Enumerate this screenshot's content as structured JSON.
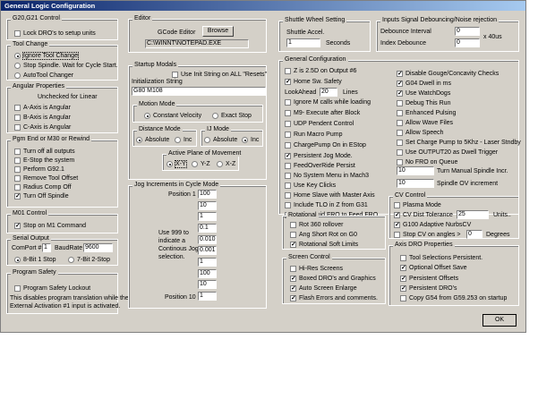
{
  "window": {
    "title": "General Logic Configuration"
  },
  "g20": {
    "title": "G20,G21 Control",
    "lock_dro": "Lock DRO's to setup units",
    "lock_dro_checked": false
  },
  "tool_change": {
    "title": "Tool Change",
    "options": [
      "Ignore Tool Change",
      "Stop Spindle. Wait for Cycle Start.",
      "AutoTool Changer"
    ],
    "selected": 0
  },
  "angular": {
    "title": "Angular Properties",
    "subtitle": "Unchecked for Linear",
    "items": [
      {
        "label": "A-Axis is Angular",
        "checked": false
      },
      {
        "label": "B-Axis is Angular",
        "checked": false
      },
      {
        "label": "C-Axis is Angular",
        "checked": false
      }
    ]
  },
  "pgm_end": {
    "title": "Pgm End or M30 or Rewind",
    "items": [
      {
        "label": "Turn off all outputs",
        "checked": false
      },
      {
        "label": "E-Stop the system",
        "checked": false
      },
      {
        "label": "Perform G92.1",
        "checked": false
      },
      {
        "label": "Remove Tool Offset",
        "checked": false
      },
      {
        "label": "Radius Comp Off",
        "checked": false
      },
      {
        "label": "Turn Off Spindle",
        "checked": true
      }
    ]
  },
  "m01": {
    "title": "M01 Control",
    "stop": "Stop on M1 Command",
    "stop_checked": true
  },
  "serial": {
    "title": "Serial Output",
    "comport_label": "ComPort #",
    "comport": "1",
    "baud_label": "BaudRate",
    "baud": "9600",
    "options": [
      "8-Bit 1 Stop",
      "7-Bit 2-Stop"
    ],
    "selected": 0
  },
  "safety": {
    "title": "Program Safety",
    "lockout": "Program Safety Lockout",
    "lockout_checked": false,
    "desc1": "This disables program translation while the",
    "desc2": "External Activation #1 input is activated."
  },
  "editor": {
    "title": "Editor",
    "label": "GCode Editor",
    "browse": "Browse",
    "path": "C:\\WINNT\\NOTEPAD.EXE"
  },
  "startup": {
    "title": "Startup Modals",
    "use_init": "Use Init String on ALL \"Resets\"",
    "use_init_checked": false,
    "init_label": "Initialization String",
    "init_value": "G80 M108",
    "motion": {
      "title": "Motion Mode",
      "options": [
        "Constant Velocity",
        "Exact Stop"
      ],
      "selected": 0
    },
    "distance": {
      "title": "Distance Mode",
      "options": [
        "Absolute",
        "Inc"
      ],
      "selected": 0
    },
    "ij": {
      "title": "IJ Mode",
      "options": [
        "Absolute",
        "Inc"
      ],
      "selected": 1
    },
    "plane": {
      "title": "Active Plane of Movement",
      "options": [
        "X-Y",
        "Y-Z",
        "X-Z"
      ],
      "selected": 0
    }
  },
  "jog": {
    "title": "Jog Increments in Cycle Mode",
    "pos1": "Position 1",
    "pos10": "Position 10",
    "note": [
      "Use 999 to",
      "indicate a",
      "Continous Jog",
      "selection."
    ],
    "values": [
      "100",
      "10",
      "1",
      "0.1",
      "0.010",
      "0.001",
      "1",
      "100",
      "10",
      "1"
    ]
  },
  "shuttle": {
    "title": "Shuttle Wheel Setting",
    "accel_label": "Shuttle Accel.",
    "accel": "1",
    "seconds": "Seconds"
  },
  "debounce": {
    "title": "Inputs Signal Debouncing/Noise rejection",
    "interval_label": "Debounce Interval",
    "interval": "0",
    "index_label": "Index Debounce",
    "index": "0",
    "unit": "x 40us"
  },
  "general": {
    "title": "General Configuration",
    "left": [
      {
        "label": "Z is 2.5D on Output #6",
        "checked": false
      },
      {
        "label": "Home Sw. Safety",
        "checked": true
      },
      {
        "label": "LookAhead",
        "value": "20",
        "suffix": "Lines"
      },
      {
        "label": "Ignore M calls while loading",
        "checked": false
      },
      {
        "label": "M9- Execute after Block",
        "checked": false
      },
      {
        "label": "UDP Pendent Control",
        "checked": false
      },
      {
        "label": "Run Macro Pump",
        "checked": false
      },
      {
        "label": "ChargePump On in EStop",
        "checked": false
      },
      {
        "label": "Persistent Jog Mode.",
        "checked": true
      },
      {
        "label": "FeedOverRide Persist",
        "checked": false
      },
      {
        "label": "No System Menu in Mach3",
        "checked": false
      },
      {
        "label": "Use Key Clicks",
        "checked": false
      },
      {
        "label": "Home Slave with Master Axis",
        "checked": false
      },
      {
        "label": "Include TLO in Z from G31",
        "checked": false
      },
      {
        "label": "Lock Rapid FRO to Feed FRO",
        "checked": true
      }
    ],
    "right": [
      {
        "label": "Disable Gouge/Concavity Checks",
        "checked": true
      },
      {
        "label": "G04 Dwell in ms",
        "checked": true
      },
      {
        "label": "Use WatchDogs",
        "checked": true
      },
      {
        "label": "Debug This Run",
        "checked": false
      },
      {
        "label": "Enhanced Pulsing",
        "checked": false
      },
      {
        "label": "Allow Wave Files",
        "checked": false
      },
      {
        "label": "Allow Speech",
        "checked": false
      },
      {
        "label": "Set Charge Pump to 5Khz - Laser Stndby",
        "checked": false
      },
      {
        "label": "Use OUTPUT20 as Dwell Trigger",
        "checked": false
      },
      {
        "label": "No FRO on Queue",
        "checked": false
      }
    ],
    "spindle_incr_value": "10",
    "spindle_incr_label": "Turn Manual Spindle Incr.",
    "spindle_ov_value": "10",
    "spindle_ov_label": "Spindle OV increment"
  },
  "rotational": {
    "title": "Rotational",
    "items": [
      {
        "label": "Rot 360 rollover",
        "checked": false
      },
      {
        "label": "Ang Short Rot on G0",
        "checked": false
      },
      {
        "label": "Rotational Soft Limits",
        "checked": true
      }
    ]
  },
  "screen": {
    "title": "Screen Control",
    "items": [
      {
        "label": "Hi-Res Screens",
        "checked": false
      },
      {
        "label": "Boxed DRO's and Graphics",
        "checked": true
      },
      {
        "label": "Auto Screen Enlarge",
        "checked": true
      },
      {
        "label": "Flash Errors and comments.",
        "checked": true
      }
    ]
  },
  "cv": {
    "title": "CV Control",
    "plasma": "Plasma Mode",
    "plasma_checked": false,
    "dist_tol": "CV Dist Tolerance",
    "dist_tol_checked": true,
    "dist_value": "25",
    "units": "Units..",
    "g100": "G100 Adaptive NurbsCV",
    "g100_checked": true,
    "stop_cv": "Stop CV on angles >",
    "stop_cv_checked": false,
    "angle": "0",
    "degrees": "Degrees"
  },
  "axisdro": {
    "title": "Axis DRO Properties",
    "items": [
      {
        "label": "Tool Selections Persistent.",
        "checked": false
      },
      {
        "label": "Optional Offset Save",
        "checked": true
      },
      {
        "label": "Persistent Offsets",
        "checked": true
      },
      {
        "label": "Persistent DRO's",
        "checked": true
      },
      {
        "label": "Copy G54 from G59.253 on startup",
        "checked": false
      }
    ]
  },
  "ok": "OK"
}
